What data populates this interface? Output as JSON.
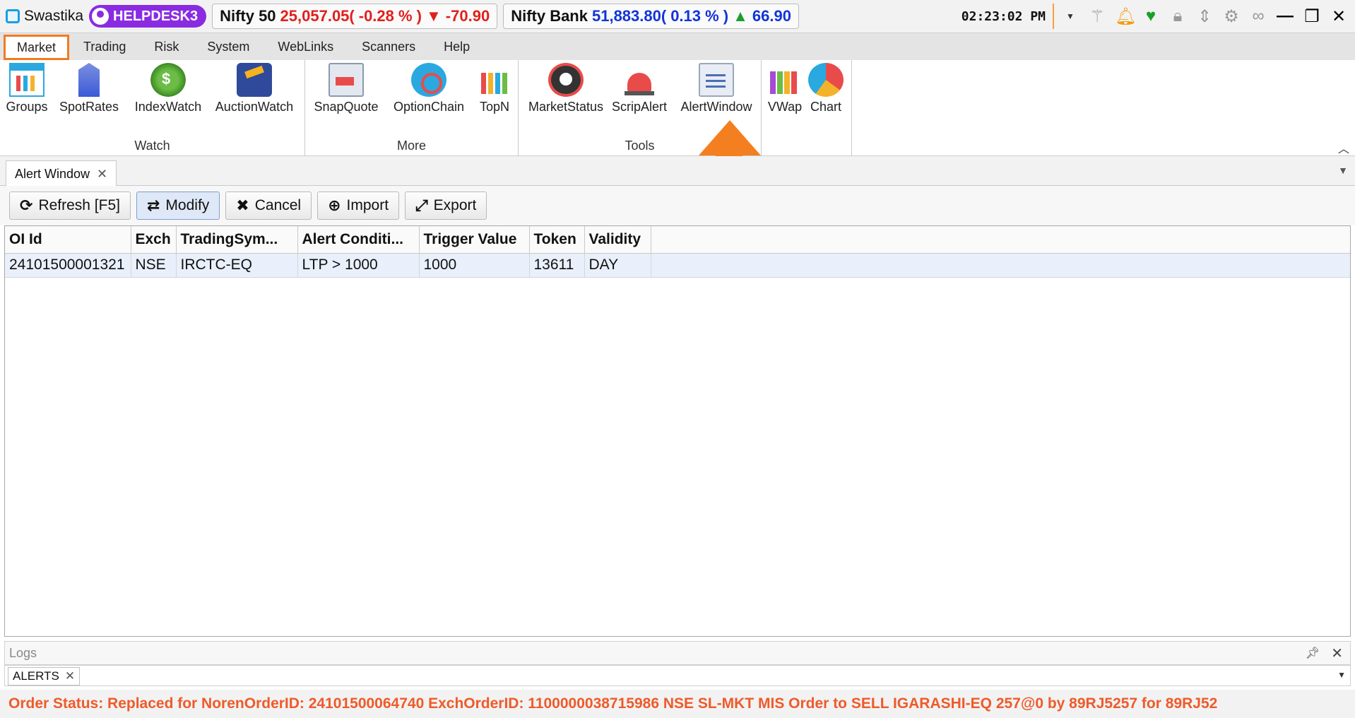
{
  "app": {
    "name": "Swastika",
    "user": "HELPDESK3",
    "clock": "02:23:02 PM"
  },
  "tickers": [
    {
      "name": "Nifty 50",
      "value": "25,057.05(",
      "change_pct": "-0.28 % )",
      "arrow": "▼",
      "change": "-70.90",
      "color": "#e0201c"
    },
    {
      "name": "Nifty Bank",
      "value": "51,883.80(",
      "change_pct": "0.13 % )",
      "arrow": "▲",
      "change": "66.90",
      "color": "#1234d8"
    }
  ],
  "title_icons": [
    "dropdown-icon",
    "magic-wand-icon",
    "bell-icon",
    "heartbeat-icon",
    "lock-icon",
    "expand-icon",
    "gear-icon",
    "link-icon",
    "minimize-icon",
    "restore-icon",
    "close-icon"
  ],
  "menu": [
    "Market",
    "Trading",
    "Risk",
    "System",
    "WebLinks",
    "Scanners",
    "Help"
  ],
  "ribbon": {
    "watch": {
      "label": "Watch",
      "buttons": [
        "Groups",
        "SpotRates",
        "IndexWatch",
        "AuctionWatch"
      ]
    },
    "more": {
      "label": "More",
      "buttons": [
        "SnapQuote",
        "OptionChain",
        "TopN"
      ]
    },
    "tools": {
      "label": "Tools",
      "buttons": [
        "MarketStatus",
        "ScripAlert",
        "AlertWindow"
      ]
    },
    "extra": {
      "buttons": [
        "VWap",
        "Chart"
      ]
    }
  },
  "doc_tab": {
    "title": "Alert Window",
    "close": "✕"
  },
  "toolbar": {
    "refresh": "Refresh [F5]",
    "modify": "Modify",
    "cancel": "Cancel",
    "import": "Import",
    "export": "Export"
  },
  "grid": {
    "columns": [
      "OI Id",
      "Exch",
      "TradingSym...",
      "Alert Conditi...",
      "Trigger Value",
      "Token",
      "Validity"
    ],
    "rows": [
      [
        "24101500001321",
        "NSE",
        "IRCTC-EQ",
        "LTP > 1000",
        "1000",
        "13611",
        "DAY"
      ]
    ]
  },
  "logs": {
    "title": "Logs",
    "tab": "ALERTS"
  },
  "status": {
    "message": "Order Status: Replaced for NorenOrderID: 24101500064740  ExchOrderID: 1100000038715986  NSE  SL-MKT  MIS  Order to SELL  IGARASHI-EQ  257@0  by 89RJ5257  for 89RJ52",
    "color": "#ef5a2a"
  },
  "colors": {
    "accent": "#f07c21",
    "helpdesk": "#8a2be2",
    "negative": "#e0201c",
    "positive": "#1234d8"
  }
}
